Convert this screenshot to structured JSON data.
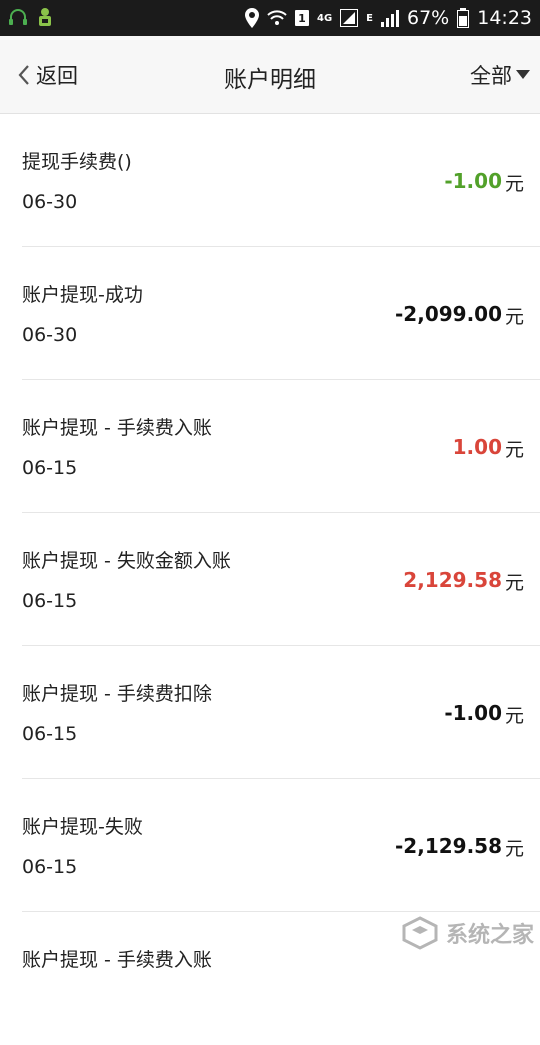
{
  "status_bar": {
    "battery": "67%",
    "time": "14:23",
    "network": "4G",
    "network_e": "E",
    "sim_slot": "1"
  },
  "header": {
    "back_label": "返回",
    "title": "账户明细",
    "filter_label": "全部"
  },
  "transactions": [
    {
      "title": "提现手续费()",
      "date": "06-30",
      "amount": "-1.00",
      "unit": "元",
      "color": "#52a12a"
    },
    {
      "title": "账户提现-成功",
      "date": "06-30",
      "amount": "-2,099.00",
      "unit": "元",
      "color": "#111111"
    },
    {
      "title": "账户提现 - 手续费入账",
      "date": "06-15",
      "amount": "1.00",
      "unit": "元",
      "color": "#d9453a"
    },
    {
      "title": "账户提现 - 失败金额入账",
      "date": "06-15",
      "amount": "2,129.58",
      "unit": "元",
      "color": "#d9453a"
    },
    {
      "title": "账户提现 - 手续费扣除",
      "date": "06-15",
      "amount": "-1.00",
      "unit": "元",
      "color": "#111111"
    },
    {
      "title": "账户提现-失败",
      "date": "06-15",
      "amount": "-2,129.58",
      "unit": "元",
      "color": "#111111"
    },
    {
      "title": "账户提现 - 手续费入账",
      "date": "",
      "amount": "",
      "unit": "",
      "color": "#111111"
    }
  ],
  "watermark": {
    "text": "系统之家"
  }
}
